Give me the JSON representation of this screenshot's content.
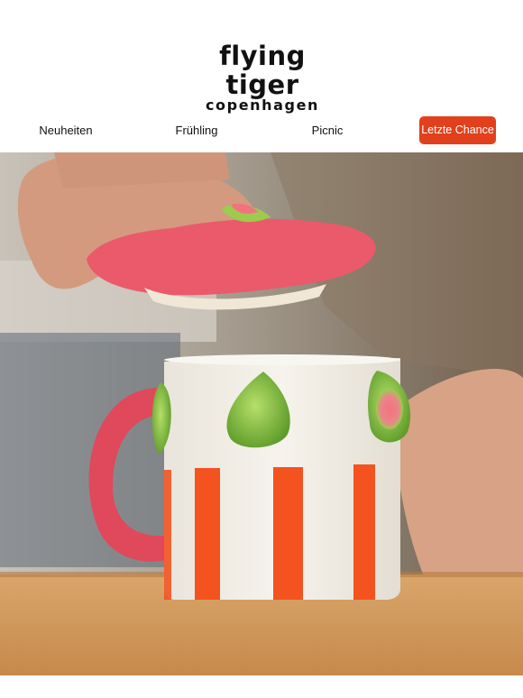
{
  "brand": {
    "logo_main": "flying tiger",
    "logo_sub": "copenhagen"
  },
  "nav": {
    "items": [
      {
        "label": "Neuheiten"
      },
      {
        "label": "Frühling"
      },
      {
        "label": "Picnic"
      }
    ],
    "cta_label": "Letzte Chance"
  },
  "colors": {
    "cta_bg": "#e2401c",
    "text": "#111111",
    "mug_stripe": "#f4521e",
    "mug_handle": "#e0485c",
    "lid_pink": "#ea5a6b",
    "fig_green": "#7bbf3a"
  },
  "hero": {
    "icon": "photo-mug-with-fig-lid"
  }
}
